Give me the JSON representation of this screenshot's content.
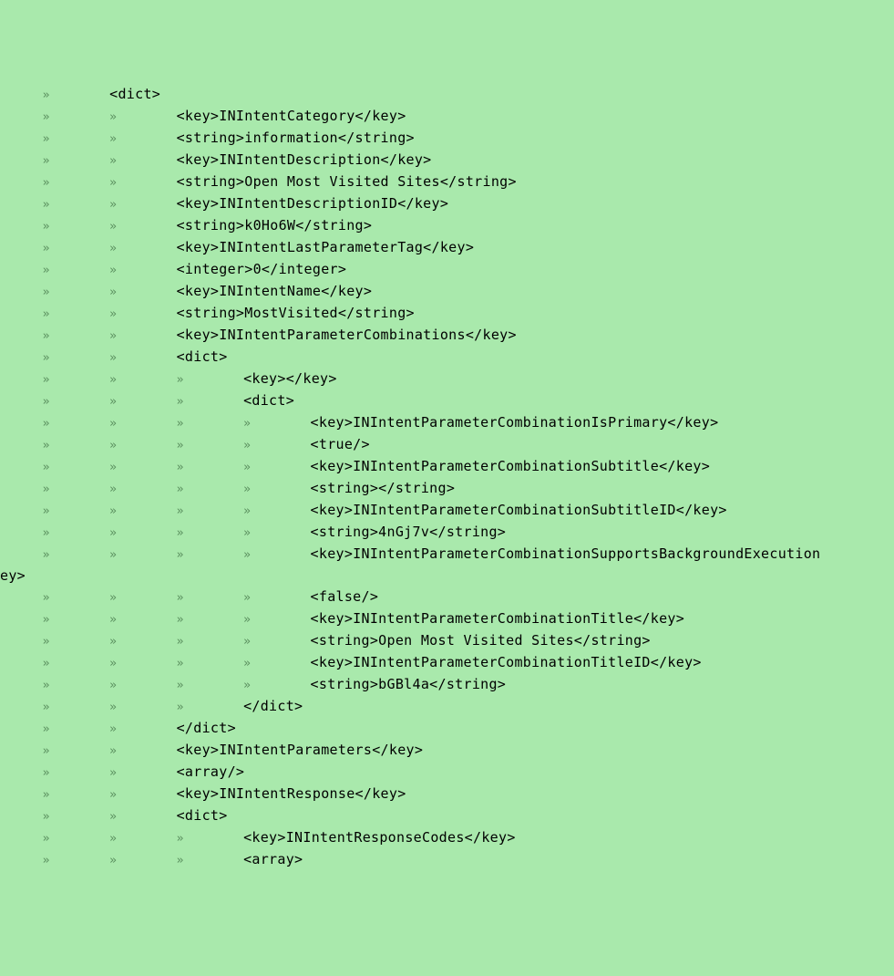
{
  "code_lines": [
    {
      "tabs": 1,
      "text": "<dict>"
    },
    {
      "tabs": 2,
      "text": "<key>INIntentCategory</key>"
    },
    {
      "tabs": 2,
      "text": "<string>information</string>"
    },
    {
      "tabs": 2,
      "text": "<key>INIntentDescription</key>"
    },
    {
      "tabs": 2,
      "text": "<string>Open Most Visited Sites</string>"
    },
    {
      "tabs": 2,
      "text": "<key>INIntentDescriptionID</key>"
    },
    {
      "tabs": 2,
      "text": "<string>k0Ho6W</string>"
    },
    {
      "tabs": 2,
      "text": "<key>INIntentLastParameterTag</key>"
    },
    {
      "tabs": 2,
      "text": "<integer>0</integer>"
    },
    {
      "tabs": 2,
      "text": "<key>INIntentName</key>"
    },
    {
      "tabs": 2,
      "text": "<string>MostVisited</string>"
    },
    {
      "tabs": 2,
      "text": "<key>INIntentParameterCombinations</key>"
    },
    {
      "tabs": 2,
      "text": "<dict>"
    },
    {
      "tabs": 3,
      "text": "<key></key>"
    },
    {
      "tabs": 3,
      "text": "<dict>"
    },
    {
      "tabs": 4,
      "text": "<key>INIntentParameterCombinationIsPrimary</key>"
    },
    {
      "tabs": 4,
      "text": "<true/>"
    },
    {
      "tabs": 4,
      "text": "<key>INIntentParameterCombinationSubtitle</key>"
    },
    {
      "tabs": 4,
      "text": "<string></string>"
    },
    {
      "tabs": 4,
      "text": "<key>INIntentParameterCombinationSubtitleID</key>"
    },
    {
      "tabs": 4,
      "text": "<string>4nGj7v</string>"
    },
    {
      "tabs": 4,
      "text": "<key>INIntentParameterCombinationSupportsBackgroundExecution",
      "wrap_continuation": "ey>"
    },
    {
      "tabs": 4,
      "text": "<false/>"
    },
    {
      "tabs": 4,
      "text": "<key>INIntentParameterCombinationTitle</key>"
    },
    {
      "tabs": 4,
      "text": "<string>Open Most Visited Sites</string>"
    },
    {
      "tabs": 4,
      "text": "<key>INIntentParameterCombinationTitleID</key>"
    },
    {
      "tabs": 4,
      "text": "<string>bGBl4a</string>"
    },
    {
      "tabs": 3,
      "text": "</dict>"
    },
    {
      "tabs": 2,
      "text": "</dict>"
    },
    {
      "tabs": 2,
      "text": "<key>INIntentParameters</key>"
    },
    {
      "tabs": 2,
      "text": "<array/>"
    },
    {
      "tabs": 2,
      "text": "<key>INIntentResponse</key>"
    },
    {
      "tabs": 2,
      "text": "<dict>"
    },
    {
      "tabs": 3,
      "text": "<key>INIntentResponseCodes</key>"
    },
    {
      "tabs": 3,
      "text": "<array>"
    }
  ],
  "indent": {
    "lead_spaces": "     ",
    "tab_mark": "»",
    "tab_gap": "       "
  }
}
